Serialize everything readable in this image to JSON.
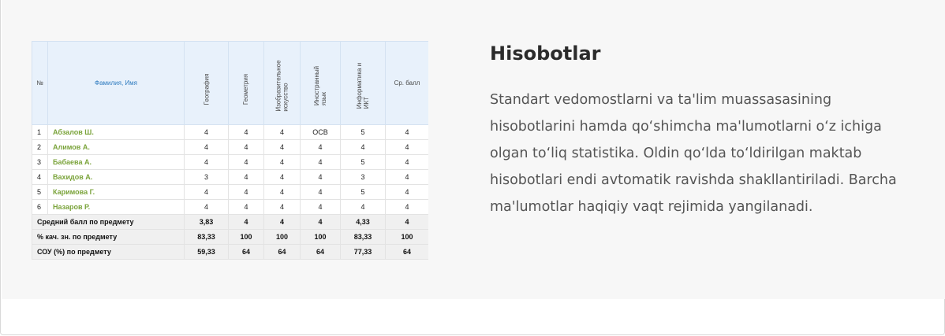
{
  "report": {
    "headers": {
      "num": "№",
      "name": "Фамилия, Имя",
      "subjects": [
        "География",
        "Геометрия",
        "Изобразительное\nискусство",
        "Иностранный\nязык",
        "Информатика и\nИКТ"
      ],
      "avg": "Ср. балл"
    },
    "rows": [
      {
        "num": "1",
        "name": "Абзалов Ш.",
        "grades": [
          "4",
          "4",
          "4",
          "ОСВ",
          "5"
        ],
        "avg": "4"
      },
      {
        "num": "2",
        "name": "Алимов А.",
        "grades": [
          "4",
          "4",
          "4",
          "4",
          "4"
        ],
        "avg": "4"
      },
      {
        "num": "3",
        "name": "Бабаева А.",
        "grades": [
          "4",
          "4",
          "4",
          "4",
          "5"
        ],
        "avg": "4"
      },
      {
        "num": "4",
        "name": "Вахидов А.",
        "grades": [
          "3",
          "4",
          "4",
          "4",
          "3"
        ],
        "avg": "4"
      },
      {
        "num": "5",
        "name": "Каримова Г.",
        "grades": [
          "4",
          "4",
          "4",
          "4",
          "5"
        ],
        "avg": "4"
      },
      {
        "num": "6",
        "name": "Назаров Р.",
        "grades": [
          "4",
          "4",
          "4",
          "4",
          "4"
        ],
        "avg": "4"
      }
    ],
    "summary": [
      {
        "label": "Средний балл по предмету",
        "values": [
          "3,83",
          "4",
          "4",
          "4",
          "4,33",
          "4"
        ]
      },
      {
        "label": "% кач. зн. по предмету",
        "values": [
          "83,33",
          "100",
          "100",
          "100",
          "83,33",
          "100"
        ]
      },
      {
        "label": "СОУ (%) по предмету",
        "values": [
          "59,33",
          "64",
          "64",
          "64",
          "77,33",
          "64"
        ]
      }
    ]
  },
  "section": {
    "title": "Hisobotlar",
    "description": "Standart vedomostlarni va ta'lim muassasasining hisobotlarini hamda qo‘shimcha ma'lumotlarni o‘z ichiga olgan to‘liq statistika. Oldin qo‘lda to‘ldirilgan maktab hisobotlari endi avtomatik ravishda shakllantiriladi. Barcha ma'lumotlar haqiqiy vaqt rejimida yangilanadi."
  }
}
